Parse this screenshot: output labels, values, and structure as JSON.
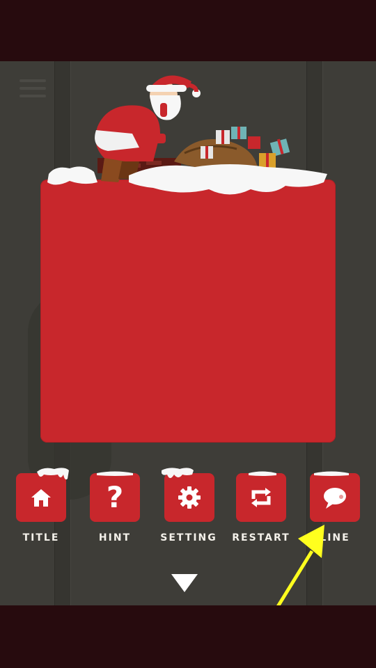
{
  "colors": {
    "background_band": "#270b0e",
    "wall": "#3e3d38",
    "panel_red": "#c8272c",
    "button_red": "#c8272c",
    "label_white": "#f4f1ea",
    "pointer_yellow": "#ffff1e"
  },
  "buttons": [
    {
      "label": "TITLE",
      "icon": "house-icon"
    },
    {
      "label": "HINT",
      "icon": "question-icon"
    },
    {
      "label": "SETTING",
      "icon": "gear-icon"
    },
    {
      "label": "RESTART",
      "icon": "restart-icon"
    },
    {
      "label": "LINE",
      "icon": "chat-bubble-icon"
    }
  ],
  "navigation": {
    "down_icon": "triangle-down-icon",
    "menu_icon": "hamburger-menu-icon"
  },
  "illustration": {
    "subject": "santa-icon"
  }
}
